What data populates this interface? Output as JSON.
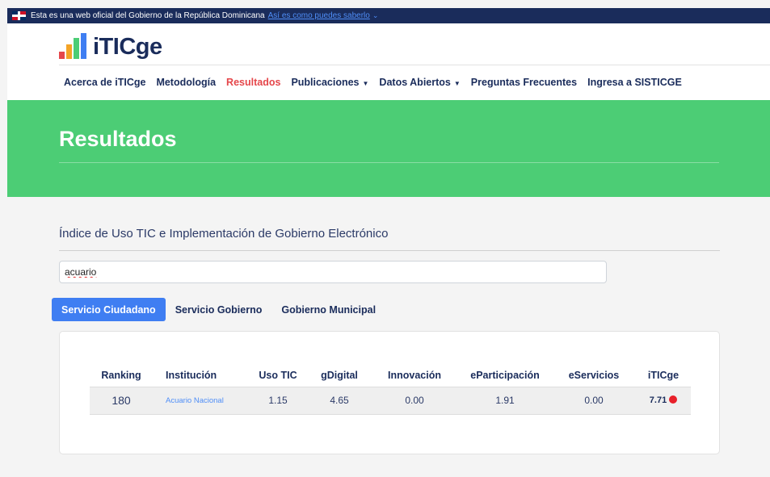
{
  "gov_banner": {
    "text": "Esta es una web oficial del Gobierno de la República Dominicana",
    "link": "Así es como puedes saberlo"
  },
  "logo": {
    "text": "iTICge",
    "bar_colors": [
      "#e5474b",
      "#f4a426",
      "#4ccd75",
      "#3f7ef2"
    ]
  },
  "nav": {
    "items": [
      {
        "label": "Acerca de iTICge",
        "active": false,
        "dropdown": false
      },
      {
        "label": "Metodología",
        "active": false,
        "dropdown": false
      },
      {
        "label": "Resultados",
        "active": true,
        "dropdown": false
      },
      {
        "label": "Publicaciones",
        "active": false,
        "dropdown": true
      },
      {
        "label": "Datos Abiertos",
        "active": false,
        "dropdown": true
      },
      {
        "label": "Preguntas Frecuentes",
        "active": false,
        "dropdown": false
      },
      {
        "label": "Ingresa a SISTICGE",
        "active": false,
        "dropdown": false
      }
    ]
  },
  "hero": {
    "title": "Resultados",
    "color": "#4ccd75"
  },
  "section": {
    "title": "Índice de Uso TIC e Implementación de Gobierno Electrónico"
  },
  "search": {
    "value": "acuario"
  },
  "tabs": [
    {
      "label": "Servicio Ciudadano",
      "active": true
    },
    {
      "label": "Servicio Gobierno",
      "active": false
    },
    {
      "label": "Gobierno Municipal",
      "active": false
    }
  ],
  "table": {
    "headers": [
      "Ranking",
      "Institución",
      "Uso TIC",
      "gDigital",
      "Innovación",
      "eParticipación",
      "eServicios",
      "iTICge"
    ],
    "rows": [
      [
        "180",
        "Acuario Nacional",
        "1.15",
        "4.65",
        "0.00",
        "1.91",
        "0.00",
        "7.71"
      ]
    ],
    "status_color": "#e8202a"
  }
}
